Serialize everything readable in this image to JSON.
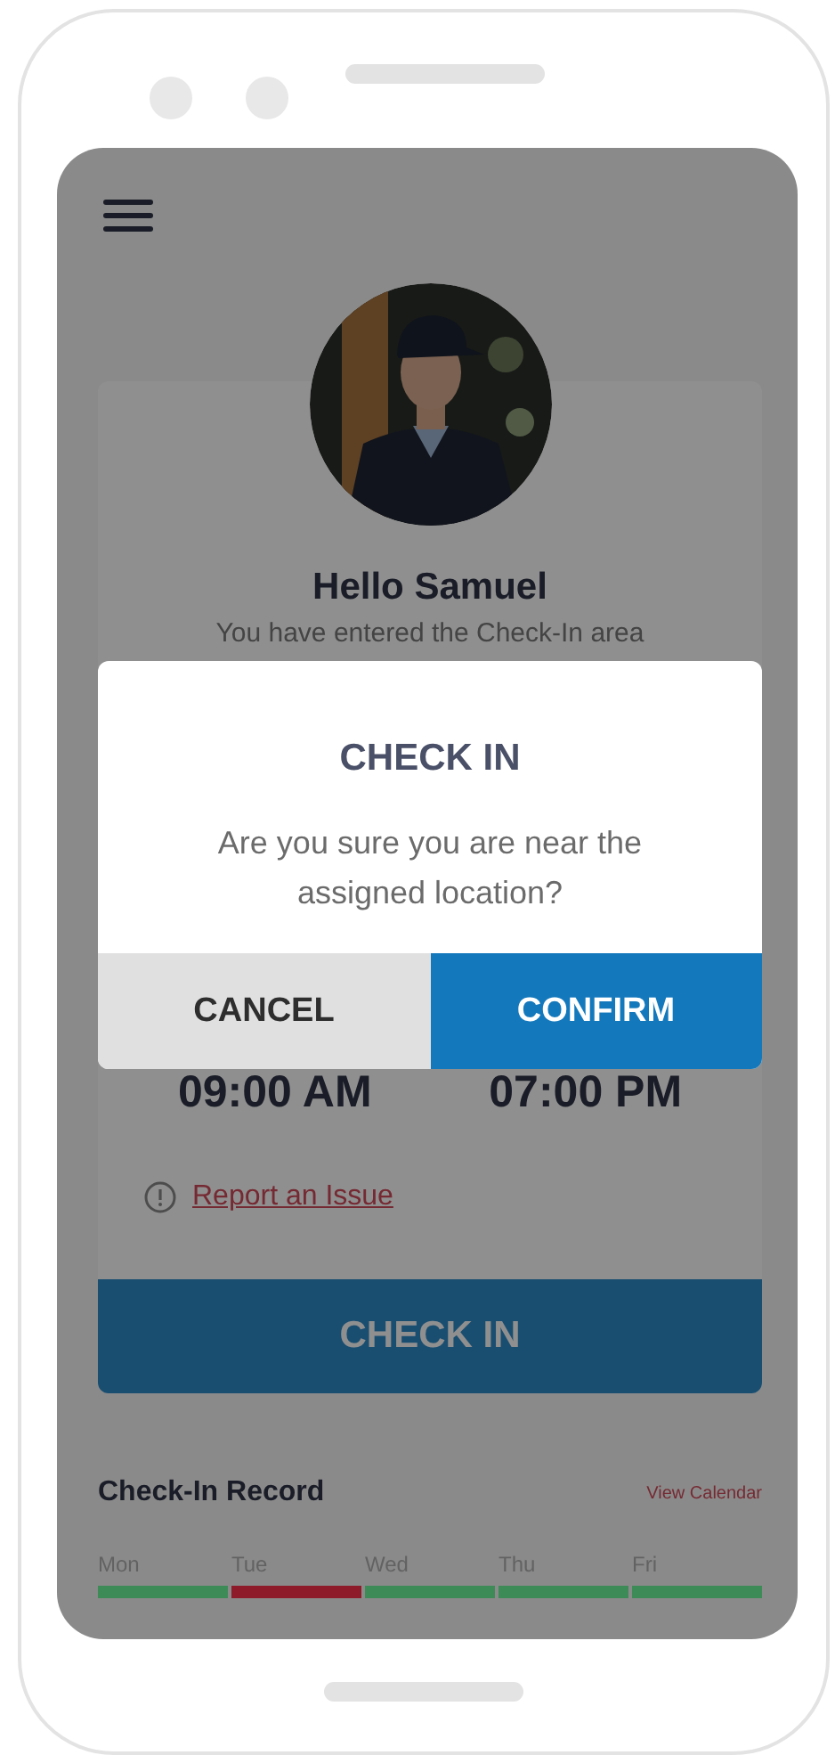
{
  "profile": {
    "greeting": "Hello Samuel",
    "subtitle": "You have entered the Check-In area"
  },
  "shift_times": [
    "09:00 AM",
    "07:00 PM"
  ],
  "report_link": "Report an Issue",
  "check_in_button": "CHECK IN",
  "record": {
    "title": "Check-In Record",
    "link": "View Calendar",
    "days": [
      {
        "label": "Mon",
        "color": "#3d8b57"
      },
      {
        "label": "Tue",
        "color": "#8e1b2a"
      },
      {
        "label": "Wed",
        "color": "#3d8b57"
      },
      {
        "label": "Thu",
        "color": "#3d8b57"
      },
      {
        "label": "Fri",
        "color": "#3d8b57"
      }
    ]
  },
  "dialog": {
    "title": "CHECK IN",
    "message": "Are you sure you are near the assigned location?",
    "buttons": [
      {
        "label": "CANCEL",
        "kind": "secondary"
      },
      {
        "label": "CONFIRM",
        "kind": "primary"
      }
    ]
  }
}
